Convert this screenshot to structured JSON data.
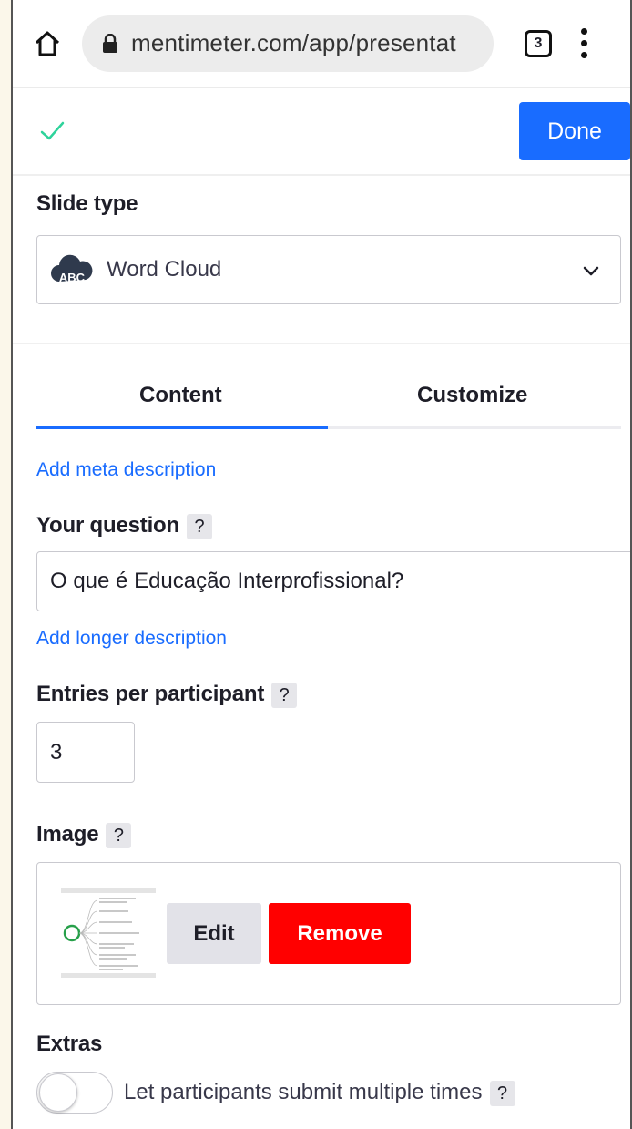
{
  "browser": {
    "url": "mentimeter.com/app/presentat",
    "tab_count": "3"
  },
  "header": {
    "done_label": "Done"
  },
  "slide_type": {
    "label": "Slide type",
    "selected": "Word Cloud",
    "icon_text": "ABC"
  },
  "tabs": [
    {
      "label": "Content",
      "active": true
    },
    {
      "label": "Customize",
      "active": false
    }
  ],
  "content": {
    "meta_link": "Add meta description",
    "question_label": "Your question",
    "question_value": "O que é Educação Interprofissional?",
    "longer_link": "Add longer description",
    "entries_label": "Entries per participant",
    "entries_value": "3",
    "image_label": "Image",
    "edit_label": "Edit",
    "remove_label": "Remove",
    "extras_label": "Extras",
    "toggle_label": "Let participants submit multiple times",
    "help": "?"
  },
  "colors": {
    "accent": "#196cff",
    "danger": "#ff0000",
    "check": "#2ed39b"
  }
}
